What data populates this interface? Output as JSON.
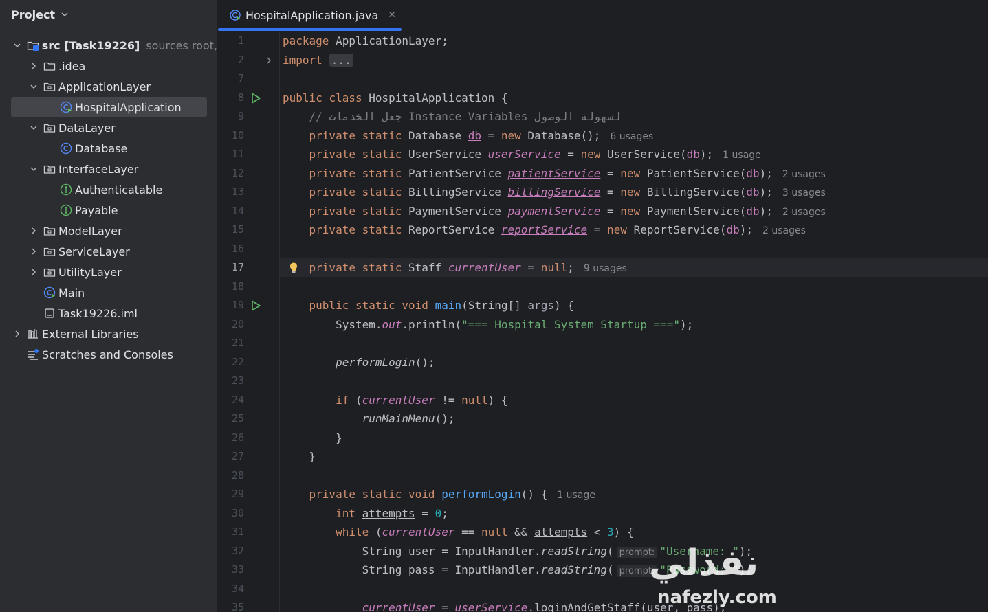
{
  "project_panel": {
    "title": "Project",
    "tree": [
      {
        "label": "src [Task19226]",
        "hint": "sources root,",
        "kind": "source-root",
        "level": 0,
        "expanded": true
      },
      {
        "label": ".idea",
        "kind": "folder",
        "level": 1,
        "expanded": false
      },
      {
        "label": "ApplicationLayer",
        "kind": "package",
        "level": 1,
        "expanded": true
      },
      {
        "label": "HospitalApplication",
        "kind": "java-class-run",
        "level": 2,
        "selected": true
      },
      {
        "label": "DataLayer",
        "kind": "package",
        "level": 1,
        "expanded": true
      },
      {
        "label": "Database",
        "kind": "java-class",
        "level": 2
      },
      {
        "label": "InterfaceLayer",
        "kind": "package",
        "level": 1,
        "expanded": true
      },
      {
        "label": "Authenticatable",
        "kind": "interface",
        "level": 2
      },
      {
        "label": "Payable",
        "kind": "interface",
        "level": 2
      },
      {
        "label": "ModelLayer",
        "kind": "package",
        "level": 1,
        "expanded": false
      },
      {
        "label": "ServiceLayer",
        "kind": "package",
        "level": 1,
        "expanded": false
      },
      {
        "label": "UtilityLayer",
        "kind": "package",
        "level": 1,
        "expanded": false
      },
      {
        "label": "Main",
        "kind": "java-class-run",
        "level": 1
      },
      {
        "label": "Task19226.iml",
        "kind": "module-file",
        "level": 1
      },
      {
        "label": "External Libraries",
        "kind": "libraries",
        "level": 0,
        "expanded": false
      },
      {
        "label": "Scratches and Consoles",
        "kind": "scratches",
        "level": 0
      }
    ]
  },
  "editor": {
    "tab": {
      "label": "HospitalApplication.java",
      "close_symbol": "✕"
    },
    "current_line": 17,
    "line_numbers": [
      "1",
      "2",
      "7",
      "8",
      "9",
      "10",
      "11",
      "12",
      "13",
      "14",
      "15",
      "16",
      "17",
      "18",
      "19",
      "20",
      "21",
      "22",
      "23",
      "24",
      "25",
      "26",
      "27",
      "28",
      "29",
      "30",
      "31",
      "32",
      "33",
      "34",
      "35"
    ],
    "run_markers_on_lines": [
      "8",
      "19"
    ],
    "fold_marker_line": "2",
    "bulb_line": "17",
    "usages": {
      "db": "6 usages",
      "userService": "1 usage",
      "patientService": "2 usages",
      "billingService": "3 usages",
      "paymentService": "2 usages",
      "reportService": "2 usages",
      "currentUser": "9 usages",
      "performLogin": "1 usage"
    },
    "prompt_hint": "prompt:",
    "comment_text": "// جعل الخدمات Instance Variables لسهولة الوصول",
    "strings": {
      "startup": "\"=== Hospital System Startup ===\"",
      "username": "\"Username: \"",
      "password": "\"Password: \""
    },
    "watermark": {
      "primary": "نفذلي",
      "secondary": "nafezly.com"
    }
  },
  "colors": {
    "panel_bg": "#2b2d30",
    "editor_bg": "#1e1f22",
    "keyword": "#cf8e6d",
    "function": "#56a8f5",
    "field": "#c77dbb",
    "string": "#6aab73",
    "number": "#2aacb8",
    "accent": "#3574f0"
  }
}
